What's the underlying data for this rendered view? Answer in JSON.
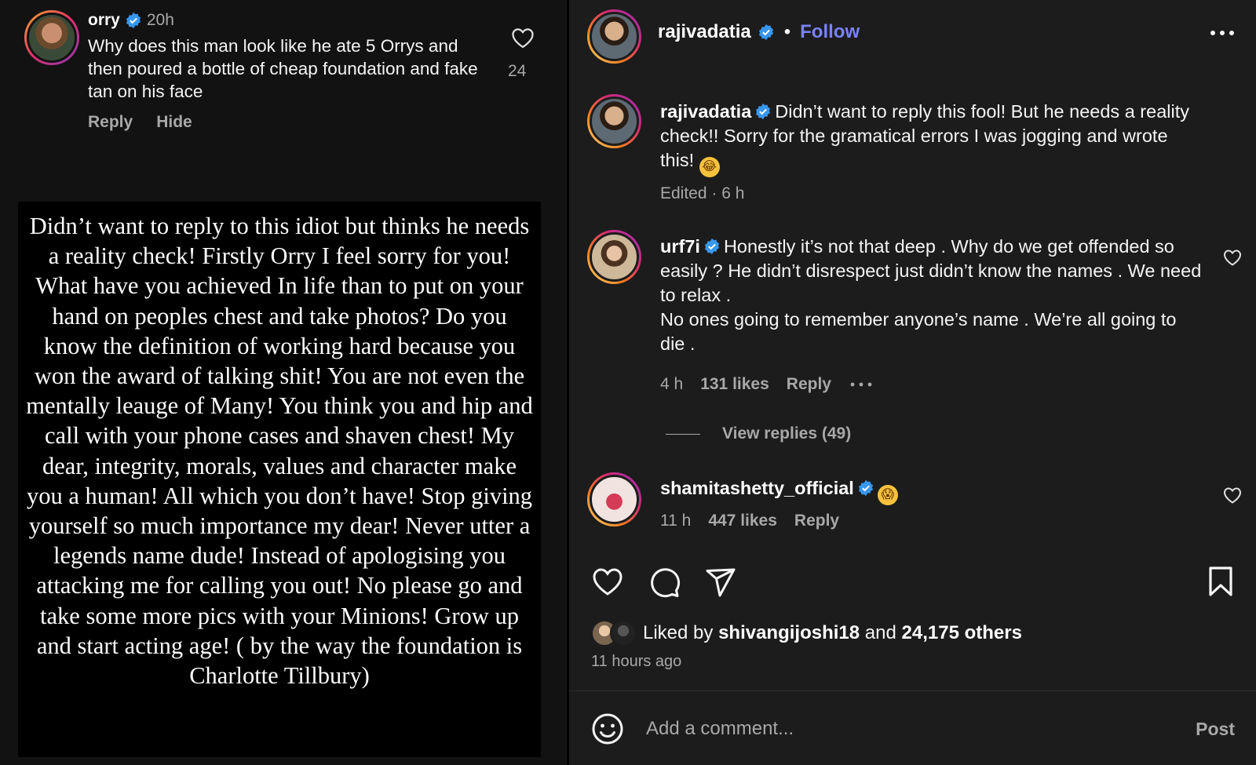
{
  "left_comment": {
    "username": "orry",
    "time": "20h",
    "text": "Why does this man look like he ate 5 Orrys and then poured a bottle of cheap foundation and fake tan on his face",
    "likes": "24",
    "reply_label": "Reply",
    "hide_label": "Hide"
  },
  "story_text": "Didn’t want to reply to this idiot but thinks he needs a reality check! Firstly Orry I feel sorry for you! What have you achieved In life than to put on your hand on peoples chest and take photos? Do you know the definition of working hard because you won the award of talking shit! You are not even the mentally leauge of Many! You think you and hip and call with your phone cases and shaven chest! My dear, integrity, morals, values and character make you a human! All which you don’t have! Stop giving yourself so much importance my dear! Never utter a legends name dude! Instead of apologising you attacking me for calling you out! No please go and take some more pics with your Minions! Grow up and start acting age! ( by the way the foundation is Charlotte Tillbury)",
  "post": {
    "author": "rajivadatia",
    "separator": "•",
    "follow_label": "Follow",
    "caption": {
      "username": "rajivadatia",
      "text": "Didn’t want to reply this fool! But he needs a reality check!! Sorry for the gramatical errors I was jogging and wrote this!",
      "emoji": "😂",
      "meta": "Edited · 6 h"
    },
    "comments": [
      {
        "username": "urf7i",
        "text_line1": "Honestly it’s not that deep . Why do we get offended so easily ? He didn’t disrespect just didn’t know the names . We need to relax .",
        "text_line2": "No ones going to remember anyone’s name . We’re all going to die .",
        "time": "4 h",
        "likes": "131 likes",
        "reply_label": "Reply",
        "view_replies": "View replies (49)"
      },
      {
        "username": "shamitashetty_official",
        "emoji": "😱",
        "time": "11 h",
        "likes": "447 likes",
        "reply_label": "Reply"
      }
    ],
    "liked_by_prefix": "Liked by",
    "liked_by_user": "shivangijoshi18",
    "liked_by_and": "and",
    "liked_by_others": "24,175 others",
    "time_ago": "11 hours ago",
    "add_comment_placeholder": "Add a comment...",
    "post_label": "Post"
  },
  "colors": {
    "verified": "#3797f0",
    "follow": "#7a82ff",
    "secondary_text": "#a8a8a8"
  }
}
